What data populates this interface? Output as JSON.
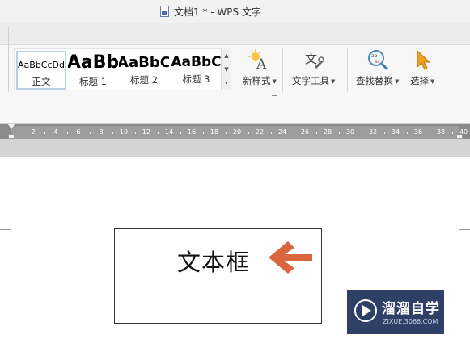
{
  "window": {
    "title": "文档1 * - WPS 文字"
  },
  "styles": {
    "items": [
      {
        "sample": "AaBbCcDd",
        "label": "正文",
        "selected": true
      },
      {
        "sample": "AaBb",
        "label": "标题 1"
      },
      {
        "sample": "AaBbC",
        "label": "标题 2"
      },
      {
        "sample": "AaBbC",
        "label": "标题 3"
      }
    ]
  },
  "tools": {
    "new_style": "新样式",
    "text_tools": "文字工具",
    "find_replace": "查找替换",
    "select": "选择"
  },
  "ruler": {
    "ticks": [
      "2",
      "4",
      "6",
      "8",
      "10",
      "12",
      "14",
      "16",
      "18",
      "20",
      "22",
      "24",
      "26",
      "28",
      "30",
      "32",
      "34",
      "36",
      "38",
      "40"
    ]
  },
  "document": {
    "textbox_text": "文本框"
  },
  "watermark": {
    "name": "溜溜自学",
    "url": "ZIXUE.3066.COM"
  },
  "colors": {
    "arrow": "#d9663f",
    "watermark_bg": "#2f3f66"
  }
}
